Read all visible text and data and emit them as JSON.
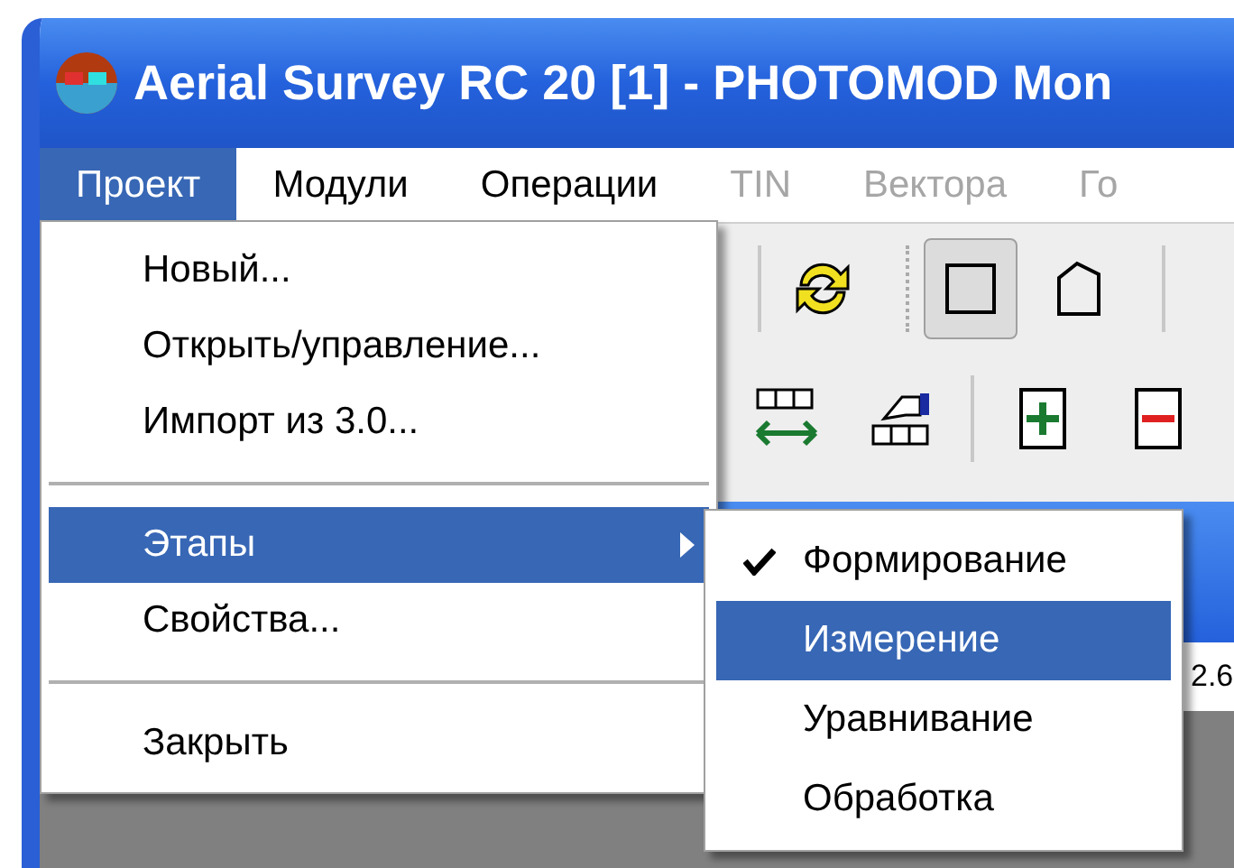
{
  "window": {
    "title": "Aerial Survey RC 20 [1] - PHOTOMOD Mon"
  },
  "menu_bar": [
    {
      "label": "Проект",
      "selected": true,
      "disabled": false
    },
    {
      "label": "Модули",
      "selected": false,
      "disabled": false
    },
    {
      "label": "Операции",
      "selected": false,
      "disabled": false
    },
    {
      "label": "TIN",
      "selected": false,
      "disabled": true
    },
    {
      "label": "Вектора",
      "selected": false,
      "disabled": true
    },
    {
      "label": "Го",
      "selected": false,
      "disabled": true
    }
  ],
  "menu": {
    "items": [
      {
        "kind": "item",
        "label": "Новый...",
        "selected": false,
        "has_submenu": false
      },
      {
        "kind": "item",
        "label": "Открыть/управление...",
        "selected": false,
        "has_submenu": false
      },
      {
        "kind": "item",
        "label": "Импорт из 3.0...",
        "selected": false,
        "has_submenu": false
      },
      {
        "kind": "separator"
      },
      {
        "kind": "item",
        "label": "Этапы",
        "selected": true,
        "has_submenu": true
      },
      {
        "kind": "item",
        "label": "Свойства...",
        "selected": false,
        "has_submenu": false
      },
      {
        "kind": "separator"
      },
      {
        "kind": "item",
        "label": "Закрыть",
        "selected": false,
        "has_submenu": false
      }
    ]
  },
  "submenu": {
    "items": [
      {
        "label": "Формирование",
        "checked": true,
        "selected": false
      },
      {
        "label": "Измерение",
        "checked": false,
        "selected": true
      },
      {
        "label": "Уравнивание",
        "checked": false,
        "selected": false
      },
      {
        "label": "Обработка",
        "checked": false,
        "selected": false
      }
    ]
  },
  "toolbar": {
    "rectangle_pressed": true
  },
  "field": {
    "value": "2.6"
  }
}
